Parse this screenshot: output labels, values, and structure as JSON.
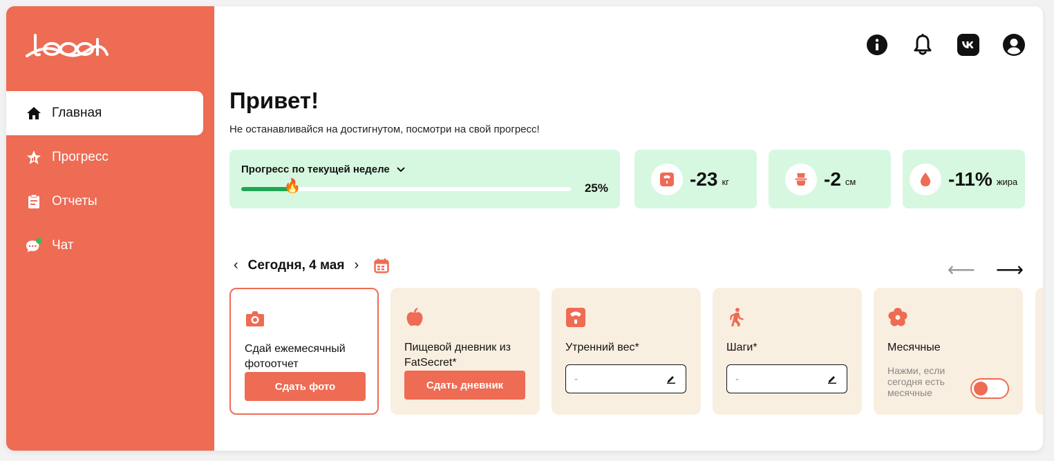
{
  "brand": {
    "logo_text": "beat",
    "accent": "#ee6b54",
    "green": "#21a555",
    "mint": "#d6f7e0",
    "cream": "#f9efe0"
  },
  "sidebar": {
    "items": [
      {
        "label": "Главная",
        "icon": "home-icon",
        "active": true
      },
      {
        "label": "Прогресс",
        "icon": "progress-star-icon",
        "active": false
      },
      {
        "label": "Отчеты",
        "icon": "clipboard-icon",
        "active": false
      },
      {
        "label": "Чат",
        "icon": "chat-icon",
        "active": false,
        "online_dot": true
      }
    ]
  },
  "header": {
    "icons": [
      "info-icon",
      "bell-icon",
      "vk-icon",
      "profile-icon"
    ]
  },
  "greeting": {
    "title": "Привет!",
    "subtitle": "Не останавливайся на достигнутом, посмотри на свой прогресс!"
  },
  "progress": {
    "label": "Прогресс по текущей неделе",
    "value_text": "25%",
    "fraction": 0.15
  },
  "stats": [
    {
      "value": "-23",
      "unit": "кг",
      "icon": "scale-icon"
    },
    {
      "value": "-2",
      "unit": "см",
      "icon": "waist-icon"
    },
    {
      "value": "-11%",
      "unit": "жира",
      "icon": "drop-icon"
    }
  ],
  "date": {
    "label": "Сегодня, 4 мая",
    "icon": "calendar-icon"
  },
  "tasks": [
    {
      "title": "Сдай ежемесячный фотоотчет",
      "icon": "camera-icon",
      "button": "Сдать фото"
    },
    {
      "title": "Пищевой дневник из FatSecret*",
      "icon": "apple-icon",
      "button": "Сдать дневник"
    },
    {
      "title": "Утренний вес*",
      "icon": "scale-icon",
      "field_value": "-"
    },
    {
      "title": "Шаги*",
      "icon": "walk-icon",
      "field_value": "-"
    },
    {
      "title": "Месячные",
      "icon": "flower-icon",
      "hint": "Нажми, если сегодня есть месячные",
      "toggle": false
    }
  ]
}
